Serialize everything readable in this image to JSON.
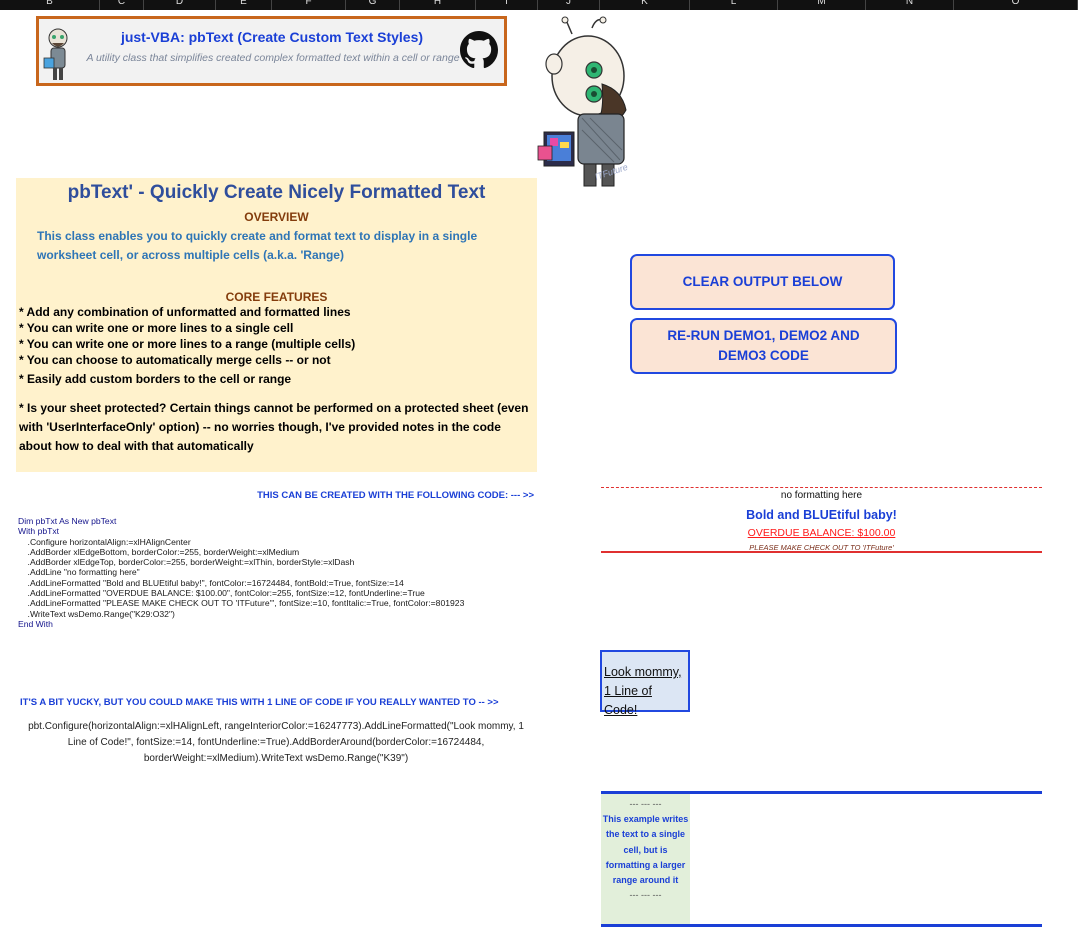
{
  "column_headers": [
    "B",
    "C",
    "D",
    "E",
    "F",
    "G",
    "H",
    "I",
    "J",
    "K",
    "L",
    "M",
    "N",
    "O"
  ],
  "banner": {
    "title": "just-VBA: pbText (Create Custom Text Styles)",
    "subtitle": "A utility class that simplifies created complex formatted text within a cell or range",
    "logo_icon": "github-icon",
    "avatar_icon": "mascot-avatar-icon"
  },
  "mascot": {
    "caption": "ITFuture"
  },
  "overview": {
    "title": "pbText' - Quickly Create Nicely Formatted Text",
    "subtitle": "OVERVIEW",
    "description": "This class enables you to quickly create and format text to display in a single worksheet cell, or across multiple cells (a.k.a. 'Range)",
    "core_title": "CORE FEATURES",
    "features": [
      "* Add any combination of unformatted and formatted lines",
      "* You can write one or more lines to a single cell",
      "* You can write one or more lines to a range (multiple cells)",
      "* You can choose to automatically merge cells -- or not",
      "* Easily add custom borders to the cell or range"
    ],
    "protect_note": "* Is your sheet protected?  Certain things cannot be performed on a protected sheet (even with 'UserInterfaceOnly' option) -- no worries though, I've provided notes in the code about how to deal with that automatically"
  },
  "code_section": {
    "heading": "THIS CAN BE CREATED WITH THE FOLLOWING CODE: --- >>",
    "lines": [
      "Dim pbTxt As New pbText",
      "With pbTxt",
      "    .Configure horizontalAlign:=xlHAlignCenter",
      "    .AddBorder xlEdgeBottom, borderColor:=255, borderWeight:=xlMedium",
      "    .AddBorder xlEdgeTop, borderColor:=255, borderWeight:=xlThin, borderStyle:=xlDash",
      "    .AddLine \"no formatting here\"",
      "    .AddLineFormatted \"Bold and BLUEtiful baby!\", fontColor:=16724484, fontBold:=True, fontSize:=14",
      "    .AddLineFormatted \"OVERDUE BALANCE: $100.00\", fontColor:=255, fontSize:=12, fontUnderline:=True",
      "    .AddLineFormatted \"PLEASE MAKE CHECK OUT TO 'ITFuture'\", fontSize:=10, fontItalic:=True, fontColor:=801923",
      "    .WriteText wsDemo.Range(\"K29:O32\")",
      "End With"
    ]
  },
  "oneline_section": {
    "heading": "IT'S A BIT YUCKY, BUT YOU COULD MAKE THIS WITH 1 LINE OF CODE IF YOU REALLY WANTED TO -- >>",
    "code": "pbt.Configure(horizontalAlign:=xlHAlignLeft, rangeInteriorColor:=16247773).AddLineFormatted(\"Look mommy, 1 Line of Code!\", fontSize:=14, fontUnderline:=True).AddBorderAround(borderColor:=16724484, borderWeight:=xlMedium).WriteText wsDemo.Range(\"K39\")"
  },
  "buttons": {
    "clear": "CLEAR OUTPUT BELOW",
    "rerun": "RE-RUN DEMO1, DEMO2 AND DEMO3 CODE"
  },
  "demo_output": {
    "line1": "no formatting here",
    "line2": "Bold and BLUEtiful baby!",
    "line3": "OVERDUE BALANCE: $100.00",
    "line4": "PLEASE MAKE CHECK OUT TO 'ITFuture'"
  },
  "mommy_box": {
    "text": "Look mommy, 1 Line of Code!"
  },
  "range_example": {
    "dashes": "--- --- ---",
    "text": "This example writes the text to a single cell, but is formatting a larger range around it"
  },
  "colors": {
    "accent_blue": "#1a3fd6",
    "banner_border": "#c8661c",
    "overview_bg": "#fff2cc",
    "button_bg": "#fbe4d5",
    "red": "#e03030",
    "mommy_bg": "#dce6f4",
    "range_cell_bg": "#e2efda"
  }
}
